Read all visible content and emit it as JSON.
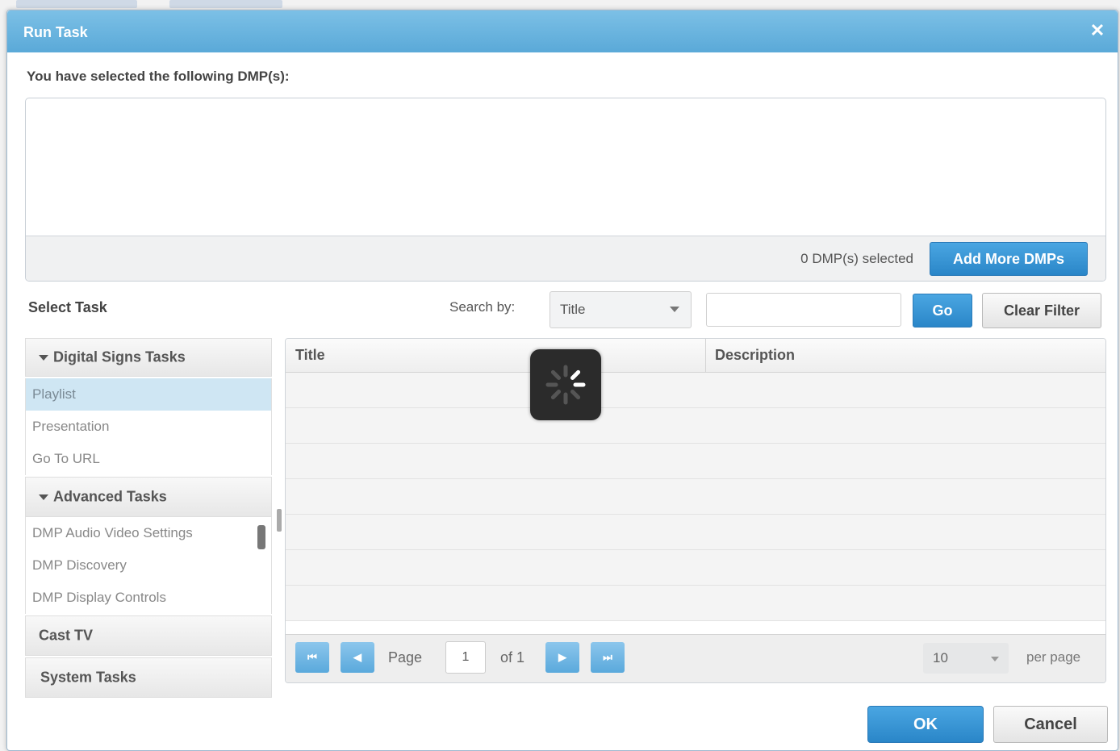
{
  "dialog": {
    "title": "Run Task",
    "close_icon": "close-icon",
    "selected_label": "You have selected the following DMP(s):"
  },
  "dmp_panel": {
    "count_text": "0 DMP(s) selected",
    "add_more_label": "Add More DMPs"
  },
  "toolbar": {
    "select_task_label": "Select Task",
    "search_by_label": "Search by:",
    "search_by_value": "Title",
    "search_value": "",
    "go_label": "Go",
    "clear_filter_label": "Clear Filter"
  },
  "task_groups": [
    {
      "label": "Digital Signs Tasks",
      "expanded": true,
      "items": [
        "Playlist",
        "Presentation",
        "Go To URL"
      ],
      "selected": "Playlist"
    },
    {
      "label": "Advanced Tasks",
      "expanded": true,
      "items": [
        "DMP Audio Video Settings",
        "DMP Discovery",
        "DMP Display Controls"
      ]
    },
    {
      "label": "Cast TV",
      "expanded": false
    },
    {
      "label": "System Tasks",
      "expanded": false
    }
  ],
  "grid": {
    "columns": [
      "Title",
      "Description"
    ],
    "rows": [],
    "loading": true
  },
  "pager": {
    "first_icon": "first-page-icon",
    "prev_icon": "prev-page-icon",
    "next_icon": "next-page-icon",
    "last_icon": "last-page-icon",
    "page_label": "Page",
    "page_value": "1",
    "of_label": "of 1",
    "per_page_value": "10",
    "per_page_label": "per page"
  },
  "footer": {
    "ok_label": "OK",
    "cancel_label": "Cancel"
  },
  "colors": {
    "titlebar": "#5aa9d8",
    "primary_button": "#2a86c8",
    "selected_row": "#cfe6f3"
  }
}
